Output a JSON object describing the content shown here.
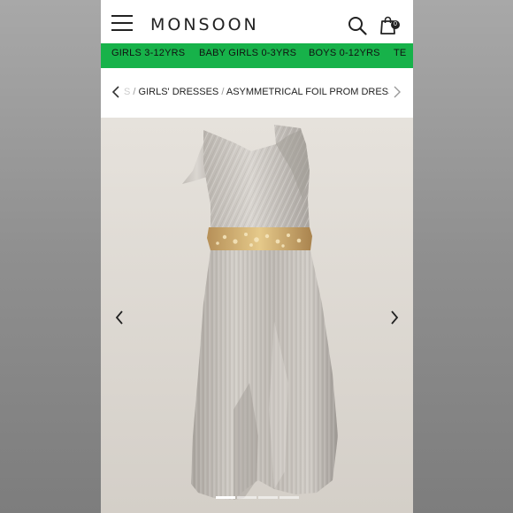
{
  "header": {
    "brand": "MONSOON",
    "bag_count": "0",
    "icons": [
      "menu-icon",
      "search-icon",
      "shopping-bag-icon"
    ]
  },
  "category_nav": {
    "background": "#17b24a",
    "items": [
      "GIRLS 3-12YRS",
      "BABY GIRLS 0-3YRS",
      "BOYS 0-12YRS",
      "TE"
    ]
  },
  "breadcrumb": {
    "truncated_start": "S",
    "separator": "/",
    "items": [
      "GIRLS' DRESSES",
      "ASYMMETRICAL FOIL PROM DRESS GREY"
    ]
  },
  "gallery": {
    "product_alt": "Asymmetrical foil prom dress grey",
    "slide_count": 4,
    "active_slide": 1
  },
  "colors": {
    "accent_green": "#17b24a",
    "dress_silver": "#c8c3bd",
    "sequin_gold": "#c9a25a"
  }
}
